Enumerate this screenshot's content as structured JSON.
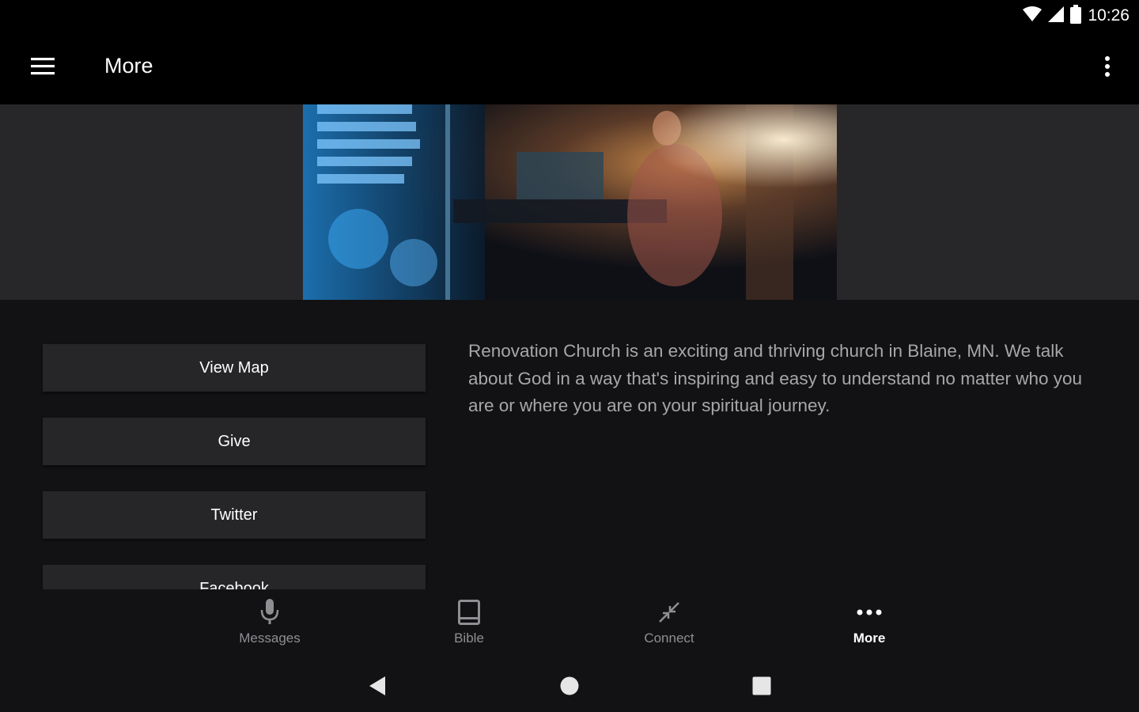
{
  "status_bar": {
    "time": "10:26",
    "icons": [
      "wifi-icon",
      "cell-signal-icon",
      "battery-icon"
    ]
  },
  "app_bar": {
    "title": "More",
    "menu_icon": "hamburger-menu-icon",
    "overflow_icon": "more-vert-icon"
  },
  "hero": {
    "image_alt": "worship-band-photo"
  },
  "actions": [
    {
      "label": "View Map"
    },
    {
      "label": "Give"
    },
    {
      "label": "Twitter"
    },
    {
      "label": "Facebook"
    }
  ],
  "description": "Renovation Church is an exciting and thriving church in Blaine, MN. We talk about God in a way that's inspiring and easy to understand no matter who you are or where you are on your spiritual journey.",
  "bottom_nav": [
    {
      "label": "Messages",
      "icon": "microphone-icon"
    },
    {
      "label": "Bible",
      "icon": "book-icon"
    },
    {
      "label": "Connect",
      "icon": "connect-arrows-icon"
    },
    {
      "label": "More",
      "icon": "more-horiz-icon",
      "active": true
    }
  ],
  "system_nav": {
    "back": "back-icon",
    "home": "home-icon",
    "recents": "recents-icon"
  },
  "colors": {
    "background": "#121214",
    "hero_band": "#272729",
    "button": "#262628",
    "text_muted": "#a7a7aa"
  }
}
